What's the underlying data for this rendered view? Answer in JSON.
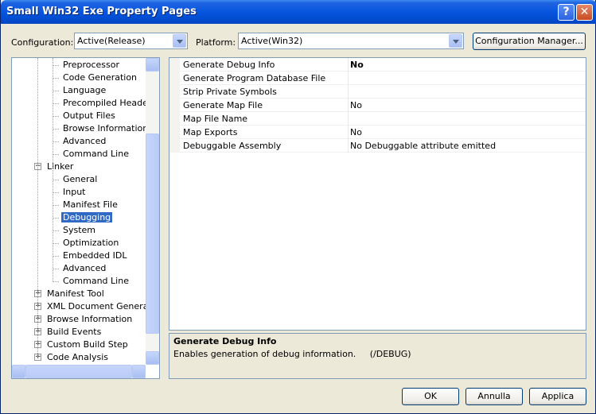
{
  "window": {
    "title": "Small Win32 Exe Property Pages"
  },
  "config_bar": {
    "configuration_label": "Configuration:",
    "configuration_value": "Active(Release)",
    "platform_label": "Platform:",
    "platform_value": "Active(Win32)",
    "manager_button": "Configuration Manager..."
  },
  "tree": {
    "items": [
      {
        "label": "Preprocessor",
        "level": 2
      },
      {
        "label": "Code Generation",
        "level": 2
      },
      {
        "label": "Language",
        "level": 2
      },
      {
        "label": "Precompiled Headers",
        "level": 2
      },
      {
        "label": "Output Files",
        "level": 2
      },
      {
        "label": "Browse Information",
        "level": 2
      },
      {
        "label": "Advanced",
        "level": 2
      },
      {
        "label": "Command Line",
        "level": 2
      },
      {
        "label": "Linker",
        "level": 1,
        "expander": "minus"
      },
      {
        "label": "General",
        "level": 2
      },
      {
        "label": "Input",
        "level": 2
      },
      {
        "label": "Manifest File",
        "level": 2
      },
      {
        "label": "Debugging",
        "level": 2,
        "selected": true
      },
      {
        "label": "System",
        "level": 2
      },
      {
        "label": "Optimization",
        "level": 2
      },
      {
        "label": "Embedded IDL",
        "level": 2
      },
      {
        "label": "Advanced",
        "level": 2
      },
      {
        "label": "Command Line",
        "level": 2
      },
      {
        "label": "Manifest Tool",
        "level": 1,
        "expander": "plus"
      },
      {
        "label": "XML Document Generator",
        "level": 1,
        "expander": "plus"
      },
      {
        "label": "Browse Information",
        "level": 1,
        "expander": "plus"
      },
      {
        "label": "Build Events",
        "level": 1,
        "expander": "plus"
      },
      {
        "label": "Custom Build Step",
        "level": 1,
        "expander": "plus"
      },
      {
        "label": "Code Analysis",
        "level": 1,
        "expander": "plus"
      }
    ]
  },
  "properties": {
    "rows": [
      {
        "name": "Generate Debug Info",
        "value": "No",
        "bold": true
      },
      {
        "name": "Generate Program Database File",
        "value": ""
      },
      {
        "name": "Strip Private Symbols",
        "value": ""
      },
      {
        "name": "Generate Map File",
        "value": "No"
      },
      {
        "name": "Map File Name",
        "value": ""
      },
      {
        "name": "Map Exports",
        "value": "No"
      },
      {
        "name": "Debuggable Assembly",
        "value": "No Debuggable attribute emitted"
      }
    ]
  },
  "description": {
    "title": "Generate Debug Info",
    "text": "Enables generation of debug information.     (/DEBUG)"
  },
  "buttons": {
    "ok": "OK",
    "cancel": "Annulla",
    "apply": "Applica"
  },
  "icons": [
    "help-icon",
    "close-icon",
    "dropdown-arrow-icon",
    "expand-icon",
    "collapse-icon",
    "scroll-up-icon",
    "scroll-down-icon",
    "scroll-left-icon",
    "scroll-right-icon"
  ]
}
